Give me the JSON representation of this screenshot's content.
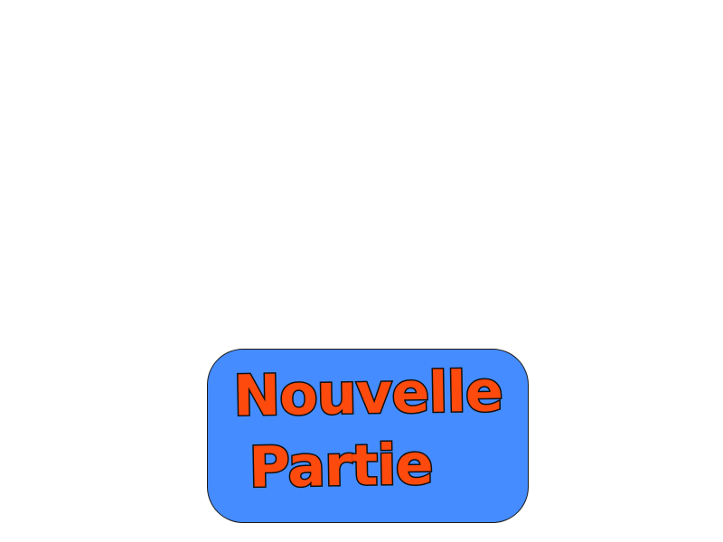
{
  "menu": {
    "new_game_line1": "Nouvelle",
    "new_game_line2": "Partie"
  },
  "colors": {
    "background": "#ffffff",
    "button_fill": "#448cff",
    "button_text": "#ff4a0d",
    "outline": "#101010"
  }
}
